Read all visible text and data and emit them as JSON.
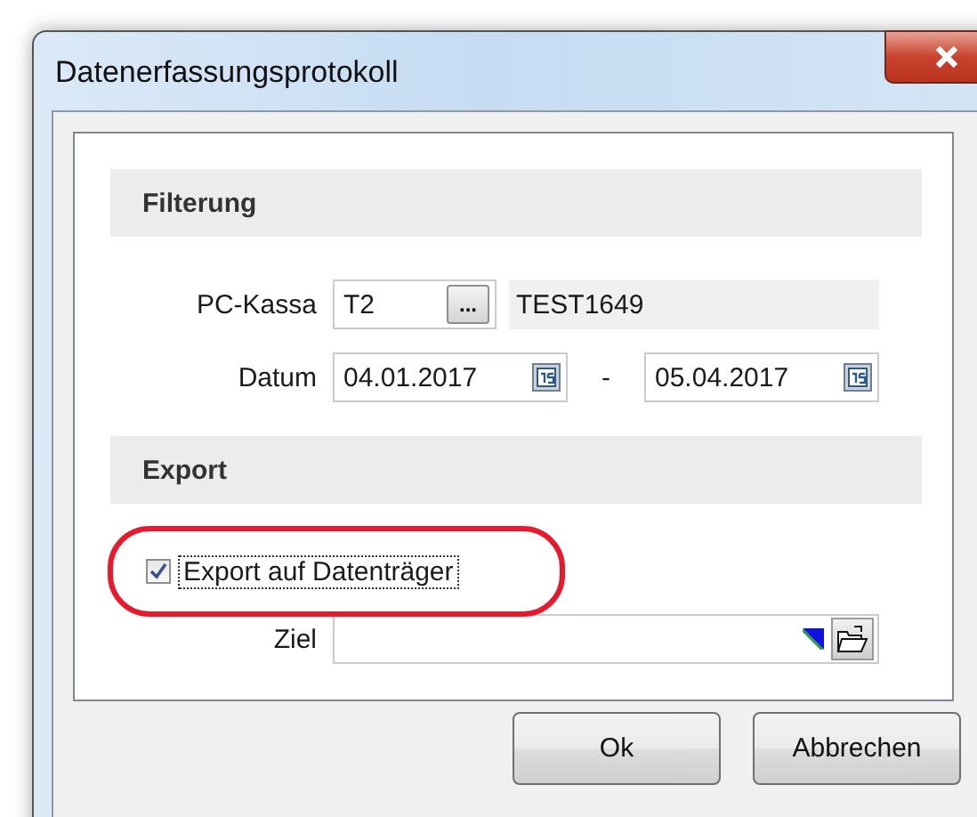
{
  "window": {
    "title": "Datenerfassungsprotokoll"
  },
  "filter": {
    "title": "Filterung",
    "pc_kassa": {
      "label": "PC-Kassa",
      "value": "T2",
      "browse": "...",
      "name": "TEST1649"
    },
    "datum": {
      "label": "Datum",
      "from": "04.01.2017",
      "separator": "-",
      "to": "05.04.2017"
    }
  },
  "export": {
    "title": "Export",
    "checkbox": {
      "label": "Export auf Datenträger",
      "checked": true
    },
    "ziel": {
      "label": "Ziel"
    }
  },
  "buttons": [
    "Ok",
    "Abbrechen"
  ]
}
